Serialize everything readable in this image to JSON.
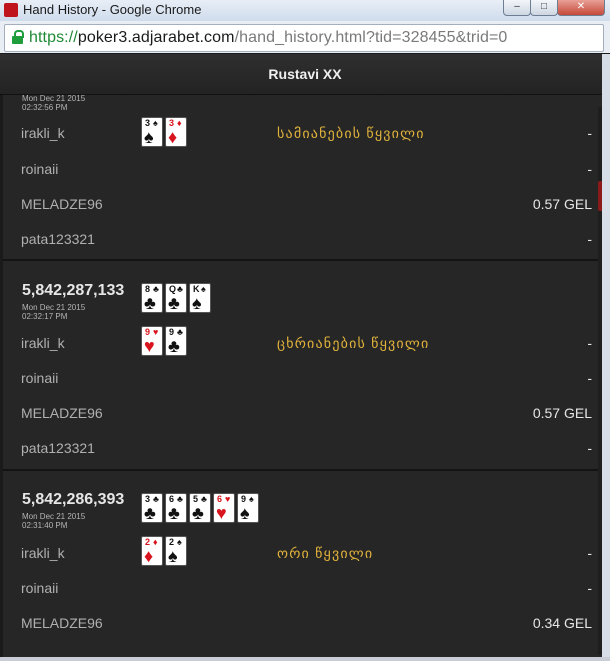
{
  "window": {
    "title": "Hand History - Google Chrome"
  },
  "address_bar": {
    "scheme": "https://",
    "host": "poker3.adjarabet.com",
    "path": "/hand_history.html?tid=328455&trid=0"
  },
  "page": {
    "title": "Rustavi XX"
  },
  "hands": [
    {
      "number": "",
      "date": "Mon Dec 21 2015",
      "time": "02:32:56 PM",
      "board": [
        {
          "rank": "",
          "suit": "♥",
          "color": "red"
        },
        {
          "rank": "",
          "suit": "♥",
          "color": "red"
        },
        {
          "rank": "",
          "suit": "♠",
          "color": "black"
        }
      ],
      "players": [
        {
          "name": "irakli_k",
          "cards": [
            {
              "rank": "3",
              "suit": "♠",
              "color": "black"
            },
            {
              "rank": "3",
              "suit": "♦",
              "color": "red"
            }
          ],
          "result": "სამიანების წყვილი",
          "amount": "-"
        },
        {
          "name": "roinaii",
          "cards": [],
          "result": "",
          "amount": "-"
        },
        {
          "name": "MELADZE96",
          "cards": [],
          "result": "",
          "amount": "0.57 GEL"
        },
        {
          "name": "pata123321",
          "cards": [],
          "result": "",
          "amount": "-"
        }
      ]
    },
    {
      "number": "5,842,287,133",
      "date": "Mon Dec 21 2015",
      "time": "02:32:17 PM",
      "board": [
        {
          "rank": "8",
          "suit": "♣",
          "color": "black"
        },
        {
          "rank": "Q",
          "suit": "♣",
          "color": "black"
        },
        {
          "rank": "K",
          "suit": "♠",
          "color": "black"
        }
      ],
      "players": [
        {
          "name": "irakli_k",
          "cards": [
            {
              "rank": "9",
              "suit": "♥",
              "color": "red"
            },
            {
              "rank": "9",
              "suit": "♣",
              "color": "black"
            }
          ],
          "result": "ცხრიანების წყვილი",
          "amount": "-"
        },
        {
          "name": "roinaii",
          "cards": [],
          "result": "",
          "amount": "-"
        },
        {
          "name": "MELADZE96",
          "cards": [],
          "result": "",
          "amount": "0.57 GEL"
        },
        {
          "name": "pata123321",
          "cards": [],
          "result": "",
          "amount": "-"
        }
      ]
    },
    {
      "number": "5,842,286,393",
      "date": "Mon Dec 21 2015",
      "time": "02:31:40 PM",
      "board": [
        {
          "rank": "3",
          "suit": "♣",
          "color": "black"
        },
        {
          "rank": "6",
          "suit": "♣",
          "color": "black"
        },
        {
          "rank": "5",
          "suit": "♣",
          "color": "black"
        },
        {
          "rank": "6",
          "suit": "♥",
          "color": "red"
        },
        {
          "rank": "9",
          "suit": "♠",
          "color": "black"
        }
      ],
      "players": [
        {
          "name": "irakli_k",
          "cards": [
            {
              "rank": "2",
              "suit": "♦",
              "color": "red"
            },
            {
              "rank": "2",
              "suit": "♠",
              "color": "black"
            }
          ],
          "result": "ორი წყვილი",
          "amount": "-"
        },
        {
          "name": "roinaii",
          "cards": [],
          "result": "",
          "amount": "-"
        },
        {
          "name": "MELADZE96",
          "cards": [],
          "result": "",
          "amount": "0.34 GEL"
        }
      ]
    }
  ]
}
